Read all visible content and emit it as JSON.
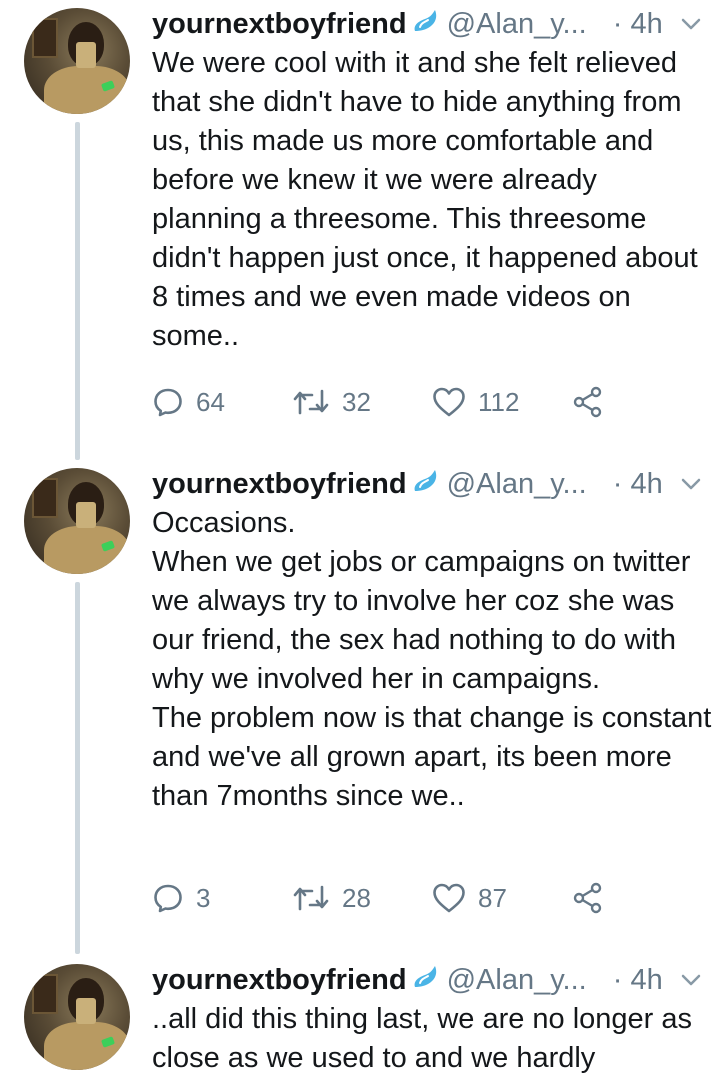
{
  "tweets": [
    {
      "author_name": "yournextboyfriend",
      "author_handle": "@Alan_y...",
      "time": "· 4h",
      "text": "We were cool with it and she felt relieved that she didn't have to hide anything from us, this made us more comfortable and before we knew it we were already planning a threesome. This threesome didn't happen just once, it happened about 8 times and we even made videos on some..",
      "replies": "64",
      "retweets": "32",
      "likes": "112"
    },
    {
      "author_name": "yournextboyfriend",
      "author_handle": "@Alan_y...",
      "time": "· 4h",
      "text": "Occasions.\nWhen we get jobs or campaigns on twitter we always try to involve her coz she was our friend, the sex had nothing to do with why we involved her in campaigns.\nThe problem now is that change is constant and we've all grown apart, its been more than 7months since we..",
      "replies": "3",
      "retweets": "28",
      "likes": "87"
    },
    {
      "author_name": "yournextboyfriend",
      "author_handle": "@Alan_y...",
      "time": "· 4h",
      "text": "..all did this thing last, we are no longer as close as we used to and we hardly"
    }
  ],
  "colors": {
    "text": "#14171a",
    "secondary": "#657786",
    "thread_line": "#ccd6dd",
    "emoji_drop": "#4ab4e6"
  },
  "icons": {
    "reply": "reply-icon",
    "retweet": "retweet-icon",
    "like": "heart-icon",
    "share": "share-icon",
    "menu": "chevron-down-icon",
    "emoji": "sweat-droplets-icon"
  }
}
